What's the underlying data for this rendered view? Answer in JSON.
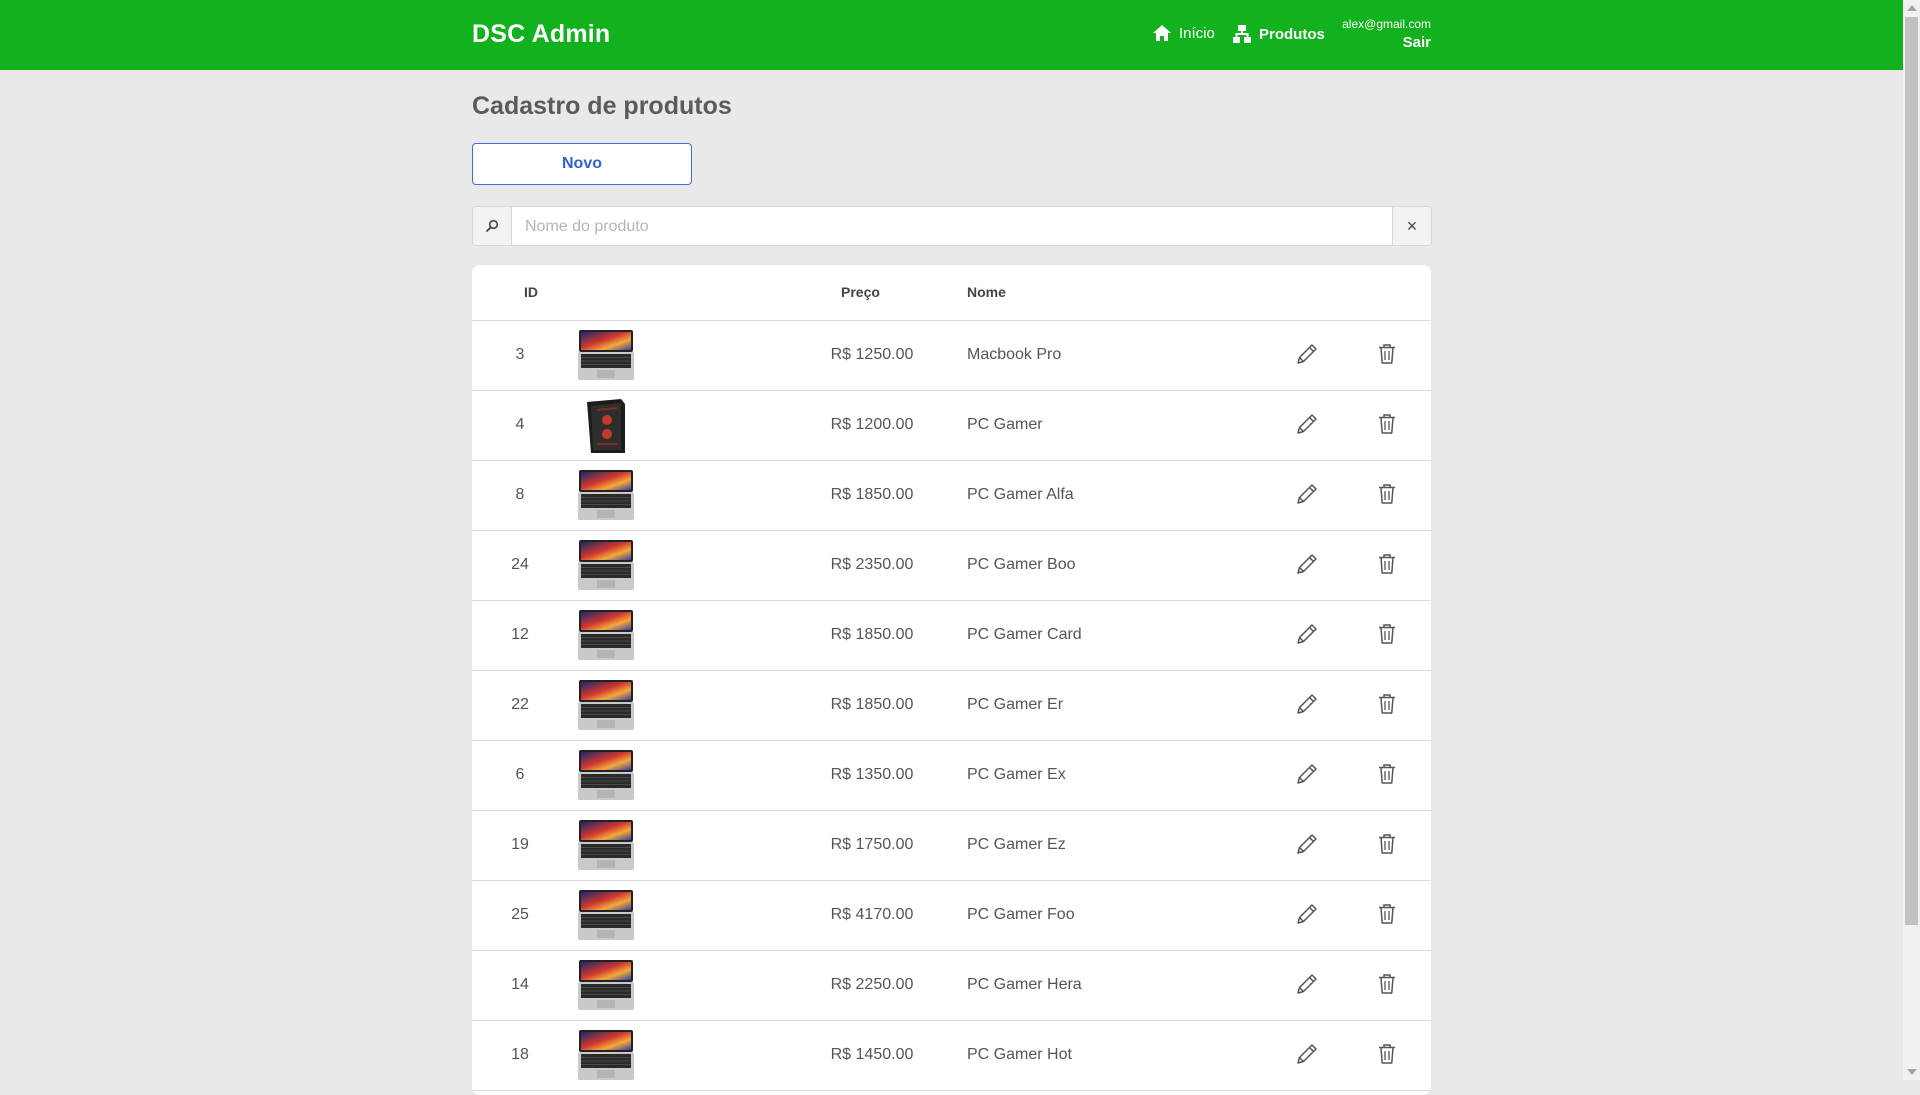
{
  "app": {
    "brand": "DSC Admin"
  },
  "nav": {
    "home_label": "Início",
    "products_label": "Produtos",
    "user_email": "alex@gmail.com",
    "logout_label": "Sair"
  },
  "page": {
    "title": "Cadastro de produtos",
    "new_button_label": "Novo"
  },
  "search": {
    "placeholder": "Nome do produto",
    "value": "",
    "clear_label": "×"
  },
  "table": {
    "headers": {
      "id": "ID",
      "price": "Preço",
      "name": "Nome"
    },
    "rows": [
      {
        "id": "3",
        "price": "R$ 1250.00",
        "name": "Macbook Pro",
        "image": "laptop"
      },
      {
        "id": "4",
        "price": "R$ 1200.00",
        "name": "PC Gamer",
        "image": "desktop-tower"
      },
      {
        "id": "8",
        "price": "R$ 1850.00",
        "name": "PC Gamer Alfa",
        "image": "laptop"
      },
      {
        "id": "24",
        "price": "R$ 2350.00",
        "name": "PC Gamer Boo",
        "image": "laptop"
      },
      {
        "id": "12",
        "price": "R$ 1850.00",
        "name": "PC Gamer Card",
        "image": "laptop"
      },
      {
        "id": "22",
        "price": "R$ 1850.00",
        "name": "PC Gamer Er",
        "image": "laptop"
      },
      {
        "id": "6",
        "price": "R$ 1350.00",
        "name": "PC Gamer Ex",
        "image": "laptop"
      },
      {
        "id": "19",
        "price": "R$ 1750.00",
        "name": "PC Gamer Ez",
        "image": "laptop"
      },
      {
        "id": "25",
        "price": "R$ 4170.00",
        "name": "PC Gamer Foo",
        "image": "laptop"
      },
      {
        "id": "14",
        "price": "R$ 2250.00",
        "name": "PC Gamer Hera",
        "image": "laptop"
      },
      {
        "id": "18",
        "price": "R$ 1450.00",
        "name": "PC Gamer Hot",
        "image": "laptop"
      }
    ]
  },
  "icons": {
    "home": "home-icon",
    "products": "sitemap-icon",
    "search": "search-icon",
    "edit": "pencil-icon",
    "delete": "trash-icon"
  },
  "colors": {
    "navbar": "#12b11e",
    "primary": "#2f63c9",
    "background": "#e9e9e9"
  }
}
